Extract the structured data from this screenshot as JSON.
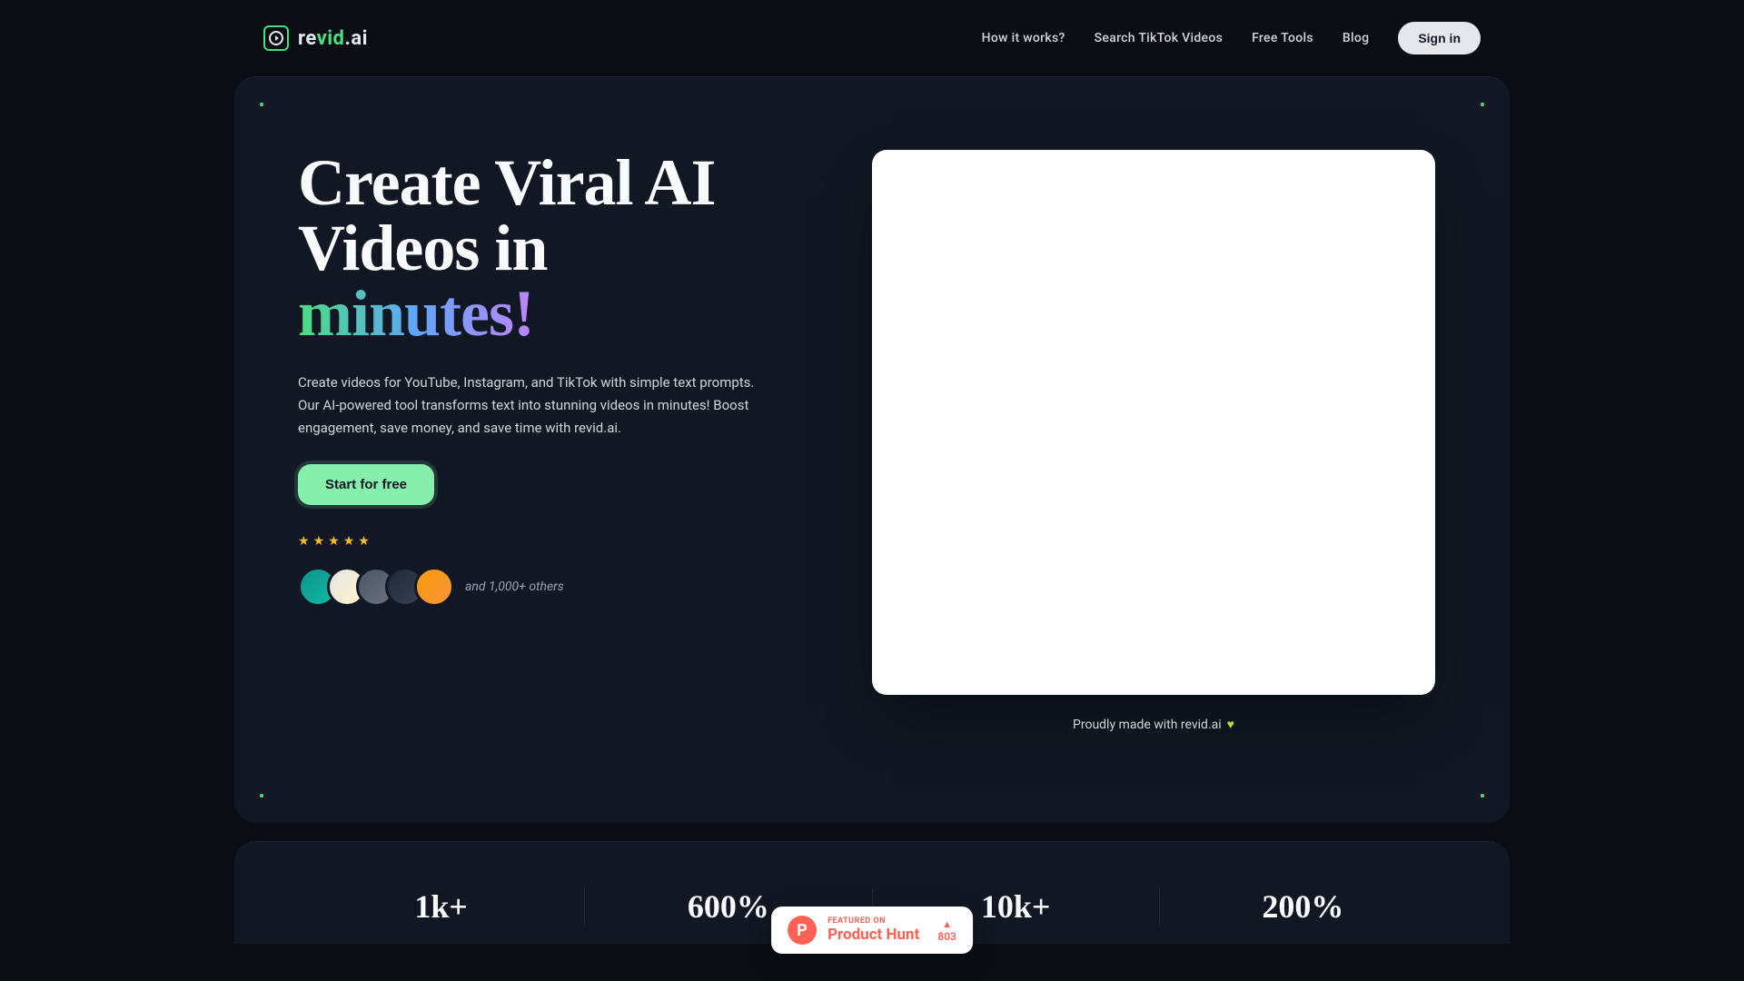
{
  "logo": {
    "re": "re",
    "vid": "vid",
    "ai": ".ai"
  },
  "nav": {
    "how_it_works": "How it works?",
    "search_tiktok": "Search TikTok Videos",
    "free_tools": "Free Tools",
    "blog": "Blog",
    "signin": "Sign in"
  },
  "hero": {
    "title_line1": "Create Viral AI Videos in",
    "title_gradient": "minutes!",
    "description": "Create videos for YouTube, Instagram, and TikTok with simple text prompts. Our AI-powered tool transforms text into stunning videos in minutes! Boost engagement, save money, and save time with revid.ai.",
    "cta": "Start for free",
    "others_text": "and 1,000+ others",
    "proudly_text": "Proudly made with revid.ai"
  },
  "stats": [
    {
      "value": "1k+"
    },
    {
      "value": "600%"
    },
    {
      "value": "10k+"
    },
    {
      "value": "200%"
    }
  ],
  "product_hunt": {
    "featured": "FEATURED ON",
    "name": "Product Hunt",
    "count": "803"
  }
}
